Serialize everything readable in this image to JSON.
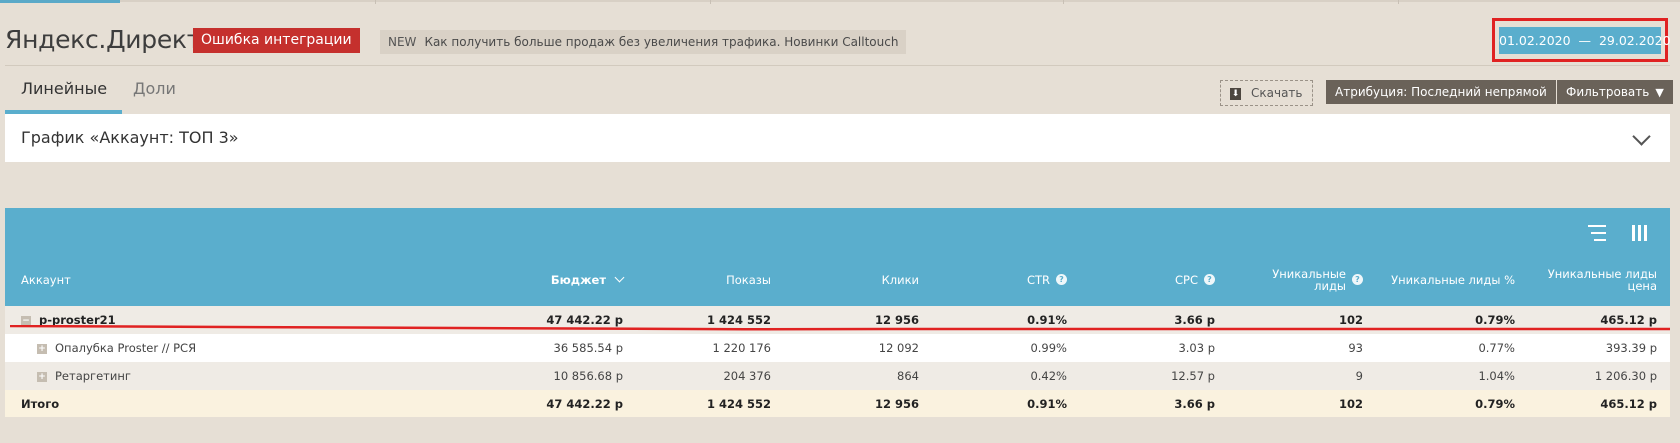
{
  "header": {
    "title": "Яндекс.Директ",
    "integration_error": "Ошибка интеграции",
    "news_tag": "NEW",
    "news_text": "Как получить больше продаж без увеличения трафика. Новинки Calltouch",
    "date_range": "01.02.2020  —  29.02.2020"
  },
  "tabs": [
    {
      "label": "Линейные",
      "active": true
    },
    {
      "label": "Доли",
      "active": false
    }
  ],
  "toolbar": {
    "download_label": "Скачать",
    "attribution_label": "Атрибуция: Последний непрямой",
    "filter_label": "Фильтровать"
  },
  "graph": {
    "title": "График «Аккаунт: ТОП 3»"
  },
  "table": {
    "columns": [
      {
        "label": "Аккаунт"
      },
      {
        "label": "Бюджет"
      },
      {
        "label": "Показы"
      },
      {
        "label": "Клики"
      },
      {
        "label": "CTR"
      },
      {
        "label": "CPC"
      },
      {
        "label": "Уникальные лиды"
      },
      {
        "label": "Уникальные лиды %"
      },
      {
        "label": "Уникальные лиды цена"
      }
    ],
    "rows": [
      {
        "name": "p-proster21",
        "toggle": "−",
        "cells": [
          "47 442.22 р",
          "1 424 552",
          "12 956",
          "0.91%",
          "3.66 р",
          "102",
          "0.79%",
          "465.12 р"
        ]
      },
      {
        "name": "Опалубка Proster // РСЯ",
        "toggle": "+",
        "cells": [
          "36 585.54 р",
          "1 220 176",
          "12 092",
          "0.99%",
          "3.03 р",
          "93",
          "0.77%",
          "393.39 р"
        ]
      },
      {
        "name": "Ретаргетинг",
        "toggle": "+",
        "cells": [
          "10 856.68 р",
          "204 376",
          "864",
          "0.42%",
          "12.57 р",
          "9",
          "1.04%",
          "1 206.30 р"
        ]
      }
    ],
    "total": {
      "name": "Итого",
      "cells": [
        "47 442.22 р",
        "1 424 552",
        "12 956",
        "0.91%",
        "3.66 р",
        "102",
        "0.79%",
        "465.12 р"
      ]
    }
  },
  "colors": {
    "accent": "#5aaecd",
    "error": "#c5302d",
    "highlight": "#e02222",
    "background": "#e6dfd5"
  }
}
